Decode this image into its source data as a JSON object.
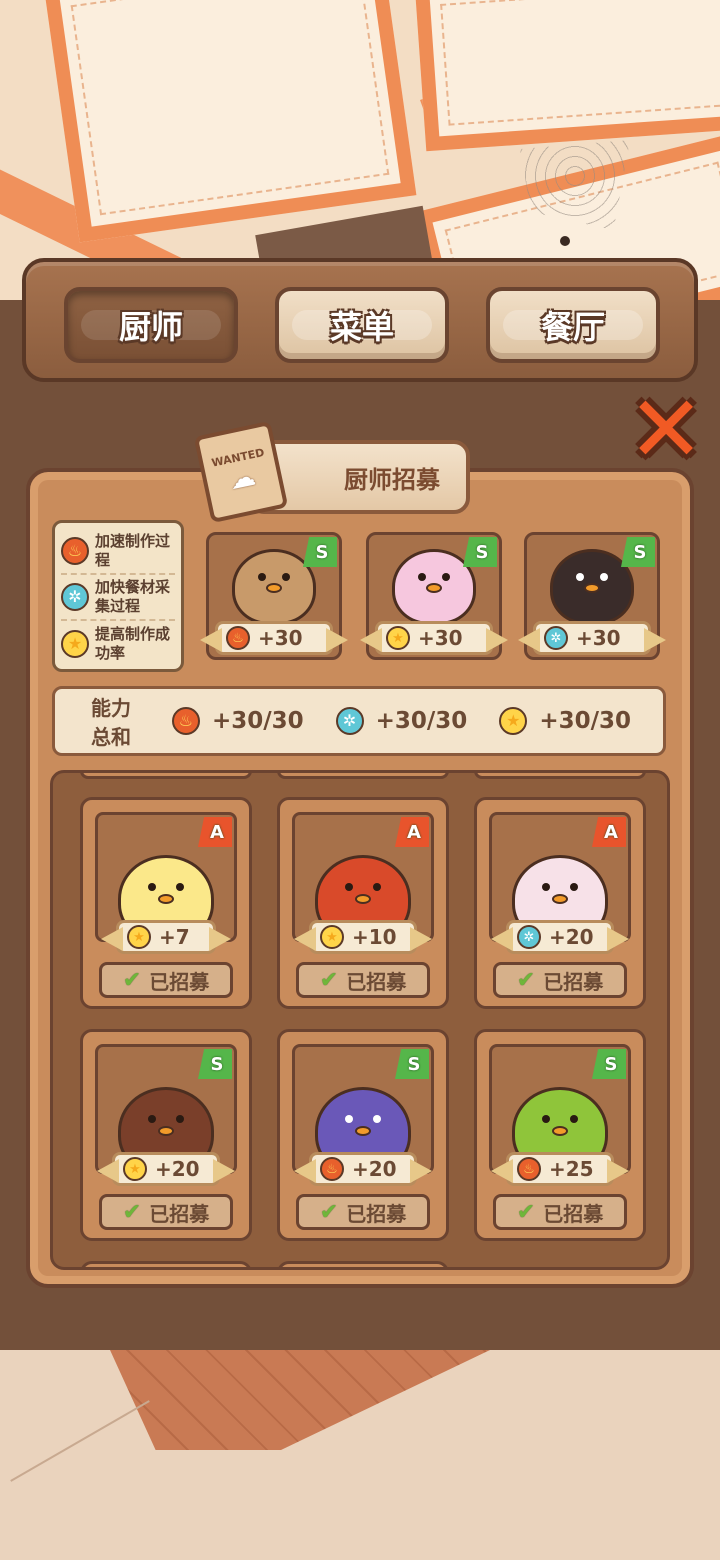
{
  "tabs": [
    {
      "label": "厨师",
      "active": true
    },
    {
      "label": "菜单",
      "active": false
    },
    {
      "label": "餐厅",
      "active": false
    }
  ],
  "panel_title": "厨师招募",
  "wanted_sign": "WANTED",
  "legend": [
    {
      "icon": "fire-icon",
      "text": "加速制作过程"
    },
    {
      "icon": "fan-icon",
      "text": "加快餐材采集过程"
    },
    {
      "icon": "star-icon",
      "text": "提高制作成功率"
    }
  ],
  "featured_chefs": [
    {
      "name": "viking-chef",
      "grade": "S",
      "stat_icon": "fire-icon",
      "bonus": "+30"
    },
    {
      "name": "pink-princess-chef",
      "grade": "S",
      "stat_icon": "star-icon",
      "bonus": "+30"
    },
    {
      "name": "pirate-chef",
      "grade": "S",
      "stat_icon": "fan-icon",
      "bonus": "+30"
    }
  ],
  "totals": {
    "label": "能力总和",
    "fire": "+30/30",
    "fan": "+30/30",
    "star": "+30/30"
  },
  "recruit_label": "已招募",
  "chefs": [
    {
      "name": "sailor-chick",
      "grade": "A",
      "stat_icon": "star-icon",
      "bonus": "+7",
      "color": "#fbe88a"
    },
    {
      "name": "lucky-red-chef",
      "grade": "A",
      "stat_icon": "star-icon",
      "bonus": "+10",
      "color": "#d94a2a"
    },
    {
      "name": "bunny-chef",
      "grade": "A",
      "stat_icon": "fan-icon",
      "bonus": "+20",
      "color": "#f7e1e8"
    },
    {
      "name": "flamingo-chef",
      "grade": "S",
      "stat_icon": "star-icon",
      "bonus": "+20",
      "color": "#7a3f2a"
    },
    {
      "name": "cap-penguin-chef",
      "grade": "S",
      "stat_icon": "fire-icon",
      "bonus": "+20",
      "color": "#6a58b8"
    },
    {
      "name": "green-bunny-chef",
      "grade": "S",
      "stat_icon": "fire-icon",
      "bonus": "+25",
      "color": "#8fc53a"
    }
  ],
  "colors": {
    "wood_dark": "#6b4330",
    "wood_mid": "#c98c5c",
    "grade_s": "#55b64a",
    "grade_a": "#e8542c",
    "close": "#f15a24"
  }
}
